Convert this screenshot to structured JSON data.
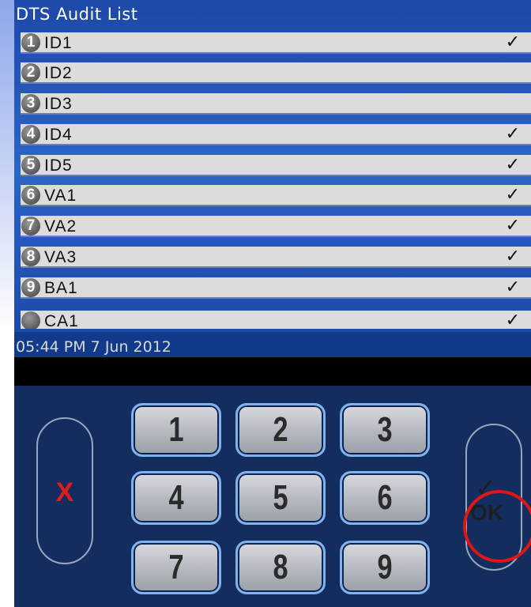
{
  "list": {
    "title": "DTS Audit List",
    "rows": [
      {
        "number": "1",
        "label": "ID1",
        "check": "✓"
      },
      {
        "number": "2",
        "label": "ID2",
        "check": ""
      },
      {
        "number": "3",
        "label": "ID3",
        "check": ""
      },
      {
        "number": "4",
        "label": "ID4",
        "check": "✓"
      },
      {
        "number": "5",
        "label": "ID5",
        "check": "✓"
      },
      {
        "number": "6",
        "label": "VA1",
        "check": "✓"
      },
      {
        "number": "7",
        "label": "VA2",
        "check": "✓"
      },
      {
        "number": "8",
        "label": "VA3",
        "check": "✓"
      },
      {
        "number": "9",
        "label": "BA1",
        "check": "✓"
      },
      {
        "number": "",
        "label": "CA1",
        "check": "✓"
      }
    ]
  },
  "status": {
    "datetime": "05:44 PM 7 Jun 2012"
  },
  "keypad": {
    "keys": [
      "1",
      "2",
      "3",
      "4",
      "5",
      "6",
      "7",
      "8",
      "9"
    ],
    "cancel_label": "X",
    "ok_label": "OK",
    "ok_check": "✓"
  },
  "colors": {
    "list_background": "#2c64c8",
    "row_background": "#dcdcdc",
    "keypad_background": "#132d5e",
    "key_border": "#7fb2ee",
    "cancel_accent": "#e11b1b",
    "highlight_ring": "#e01515"
  }
}
